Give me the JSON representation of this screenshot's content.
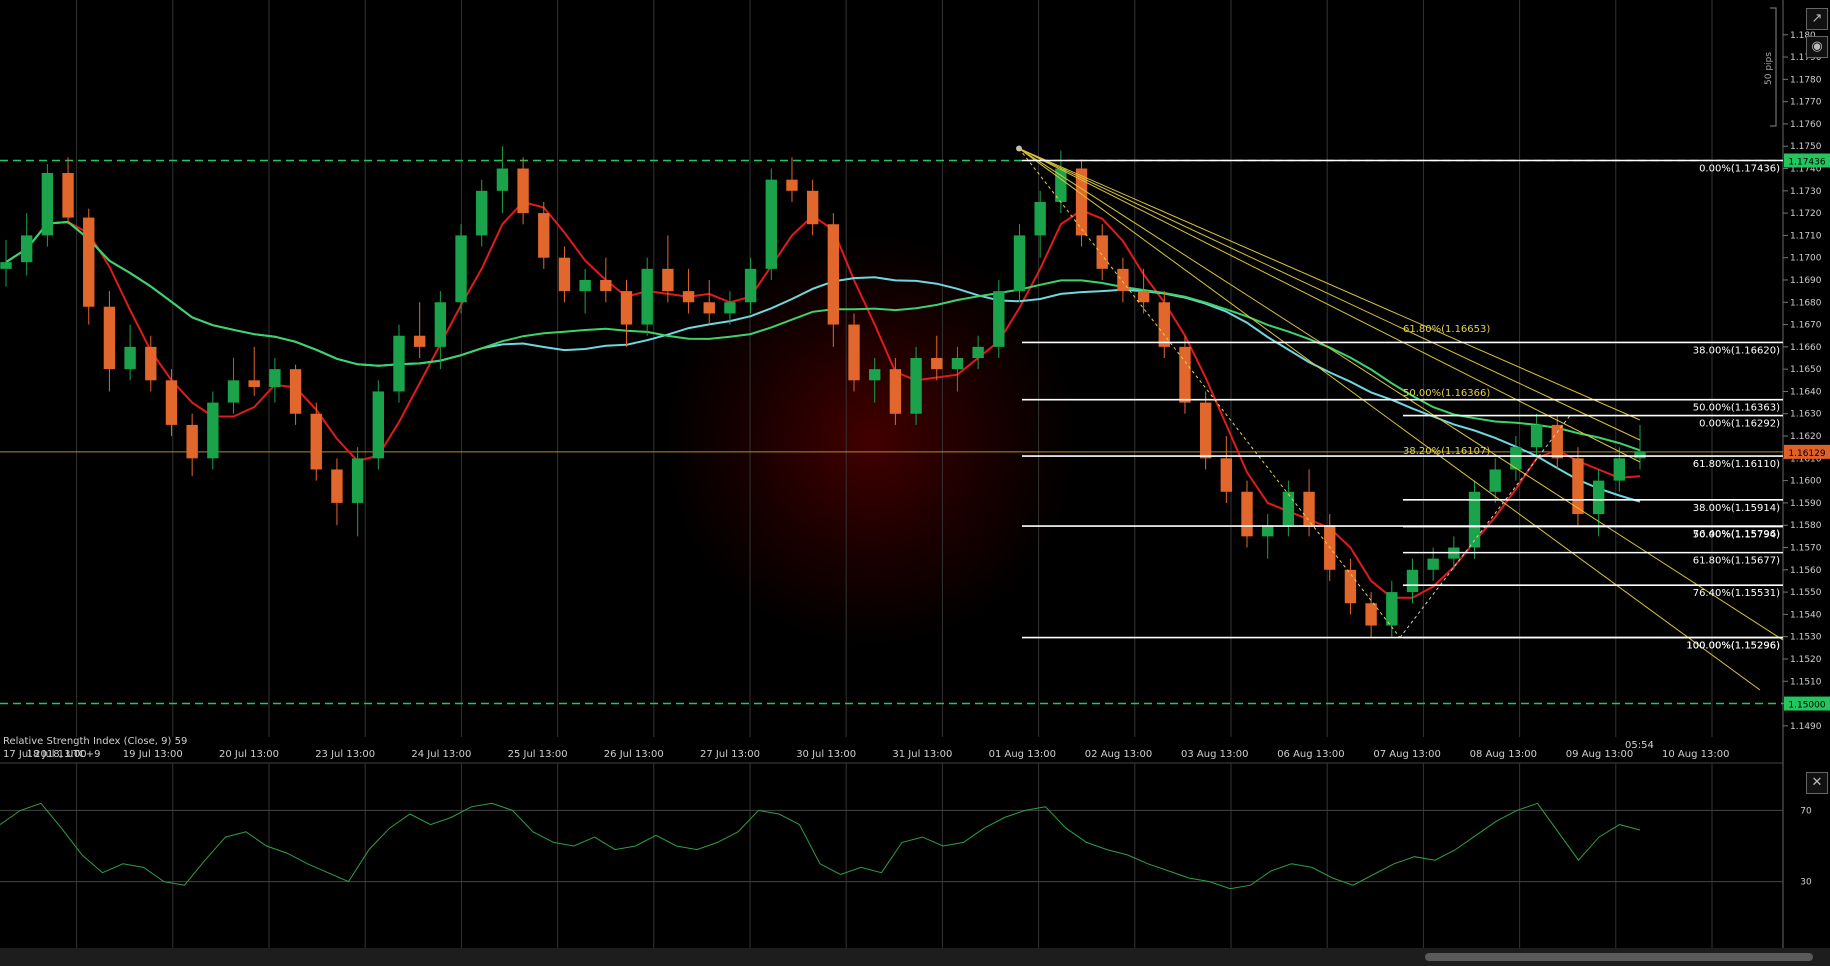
{
  "chart_data": [
    {
      "type": "line",
      "symbol": "",
      "y_range": [
        1.1485,
        1.1812
      ],
      "x_labels": [
        "17 Jul 2018, UTC+9",
        "18 Jul 13:00",
        "19 Jul 13:00",
        "20 Jul 13:00",
        "23 Jul 13:00",
        "24 Jul 13:00",
        "25 Jul 13:00",
        "26 Jul 13:00",
        "27 Jul 13:00",
        "30 Jul 13:00",
        "31 Jul 13:00",
        "01 Aug 13:00",
        "02 Aug 13:00",
        "03 Aug 13:00",
        "06 Aug 13:00",
        "07 Aug 13:00",
        "08 Aug 13:00",
        "09 Aug 13:00",
        "10 Aug 13:00"
      ],
      "y_ticks": [
        "1.1490",
        "1.1500",
        "1.1510",
        "1.1520",
        "1.1530",
        "1.1540",
        "1.1550",
        "1.1560",
        "1.1570",
        "1.1580",
        "1.1590",
        "1.1600",
        "1.1610",
        "1.1620",
        "1.1630",
        "1.1640",
        "1.1650",
        "1.1660",
        "1.1670",
        "1.1680",
        "1.1690",
        "1.1700",
        "1.1710",
        "1.1720",
        "1.1730",
        "1.1740",
        "1.1750",
        "1.1760",
        "1.1770",
        "1.1780",
        "1.1790",
        "1.180"
      ],
      "scale_label": "50 pips",
      "current_price": "1.16129",
      "horizontal_levels": [
        {
          "label": "1.17436",
          "value": 1.17436,
          "color": "#22c55e"
        },
        {
          "label": "1.15000",
          "value": 1.15,
          "color": "#22c55e"
        }
      ],
      "fib_sets": [
        {
          "color": "#ffffff",
          "levels": [
            {
              "label": "0.00%(1.17436)",
              "value": 1.17436
            },
            {
              "label": "38.00%(1.16620)",
              "value": 1.1662
            },
            {
              "label": "50.00%(1.16363)",
              "value": 1.16363
            },
            {
              "label": "61.80%(1.16110)",
              "value": 1.1611
            },
            {
              "label": "76.40%(1.15796)",
              "value": 1.15796
            },
            {
              "label": "100.00%(1.15296)",
              "value": 1.15296
            }
          ]
        },
        {
          "color": "#ffffff",
          "levels": [
            {
              "label": "0.00%(1.16292)",
              "value": 1.16292
            },
            {
              "label": "38.00%(1.15914)",
              "value": 1.15914
            },
            {
              "label": "50.00%(1.15794)",
              "value": 1.15794
            },
            {
              "label": "61.80%(1.15677)",
              "value": 1.15677
            },
            {
              "label": "76.40%(1.15531)",
              "value": 1.15531
            },
            {
              "label": "100.00%(1.15296)",
              "value": 1.15296
            }
          ]
        },
        {
          "color": "#e6d24a",
          "levels": [
            {
              "label": "61.80%(1.16653)",
              "value": 1.16653
            },
            {
              "label": "50.00%(1.16366)",
              "value": 1.16366
            },
            {
              "label": "38.20%(1.16107)",
              "value": 1.16107
            }
          ]
        }
      ],
      "candles": [
        {
          "o": 1.1695,
          "h": 1.1708,
          "l": 1.1687,
          "c": 1.1698
        },
        {
          "o": 1.1698,
          "h": 1.172,
          "l": 1.1692,
          "c": 1.171
        },
        {
          "o": 1.171,
          "h": 1.1742,
          "l": 1.1705,
          "c": 1.1738
        },
        {
          "o": 1.1738,
          "h": 1.1745,
          "l": 1.1715,
          "c": 1.1718
        },
        {
          "o": 1.1718,
          "h": 1.1722,
          "l": 1.167,
          "c": 1.1678
        },
        {
          "o": 1.1678,
          "h": 1.1685,
          "l": 1.164,
          "c": 1.165
        },
        {
          "o": 1.165,
          "h": 1.167,
          "l": 1.1645,
          "c": 1.166
        },
        {
          "o": 1.166,
          "h": 1.1665,
          "l": 1.164,
          "c": 1.1645
        },
        {
          "o": 1.1645,
          "h": 1.165,
          "l": 1.162,
          "c": 1.1625
        },
        {
          "o": 1.1625,
          "h": 1.163,
          "l": 1.1602,
          "c": 1.161
        },
        {
          "o": 1.161,
          "h": 1.164,
          "l": 1.1605,
          "c": 1.1635
        },
        {
          "o": 1.1635,
          "h": 1.1655,
          "l": 1.163,
          "c": 1.1645
        },
        {
          "o": 1.1645,
          "h": 1.166,
          "l": 1.1638,
          "c": 1.1642
        },
        {
          "o": 1.1642,
          "h": 1.1655,
          "l": 1.1635,
          "c": 1.165
        },
        {
          "o": 1.165,
          "h": 1.1652,
          "l": 1.1625,
          "c": 1.163
        },
        {
          "o": 1.163,
          "h": 1.1635,
          "l": 1.16,
          "c": 1.1605
        },
        {
          "o": 1.1605,
          "h": 1.161,
          "l": 1.158,
          "c": 1.159
        },
        {
          "o": 1.159,
          "h": 1.1615,
          "l": 1.1575,
          "c": 1.161
        },
        {
          "o": 1.161,
          "h": 1.1645,
          "l": 1.1605,
          "c": 1.164
        },
        {
          "o": 1.164,
          "h": 1.167,
          "l": 1.1635,
          "c": 1.1665
        },
        {
          "o": 1.1665,
          "h": 1.168,
          "l": 1.1655,
          "c": 1.166
        },
        {
          "o": 1.166,
          "h": 1.1685,
          "l": 1.165,
          "c": 1.168
        },
        {
          "o": 1.168,
          "h": 1.1715,
          "l": 1.1675,
          "c": 1.171
        },
        {
          "o": 1.171,
          "h": 1.1735,
          "l": 1.1705,
          "c": 1.173
        },
        {
          "o": 1.173,
          "h": 1.175,
          "l": 1.172,
          "c": 1.174
        },
        {
          "o": 1.174,
          "h": 1.1745,
          "l": 1.1715,
          "c": 1.172
        },
        {
          "o": 1.172,
          "h": 1.1725,
          "l": 1.1695,
          "c": 1.17
        },
        {
          "o": 1.17,
          "h": 1.1705,
          "l": 1.168,
          "c": 1.1685
        },
        {
          "o": 1.1685,
          "h": 1.1695,
          "l": 1.1675,
          "c": 1.169
        },
        {
          "o": 1.169,
          "h": 1.17,
          "l": 1.168,
          "c": 1.1685
        },
        {
          "o": 1.1685,
          "h": 1.169,
          "l": 1.166,
          "c": 1.167
        },
        {
          "o": 1.167,
          "h": 1.17,
          "l": 1.1665,
          "c": 1.1695
        },
        {
          "o": 1.1695,
          "h": 1.171,
          "l": 1.168,
          "c": 1.1685
        },
        {
          "o": 1.1685,
          "h": 1.1695,
          "l": 1.1675,
          "c": 1.168
        },
        {
          "o": 1.168,
          "h": 1.169,
          "l": 1.167,
          "c": 1.1675
        },
        {
          "o": 1.1675,
          "h": 1.1685,
          "l": 1.167,
          "c": 1.168
        },
        {
          "o": 1.168,
          "h": 1.17,
          "l": 1.1675,
          "c": 1.1695
        },
        {
          "o": 1.1695,
          "h": 1.174,
          "l": 1.169,
          "c": 1.1735
        },
        {
          "o": 1.1735,
          "h": 1.1745,
          "l": 1.1725,
          "c": 1.173
        },
        {
          "o": 1.173,
          "h": 1.1735,
          "l": 1.171,
          "c": 1.1715
        },
        {
          "o": 1.1715,
          "h": 1.172,
          "l": 1.166,
          "c": 1.167
        },
        {
          "o": 1.167,
          "h": 1.1675,
          "l": 1.164,
          "c": 1.1645
        },
        {
          "o": 1.1645,
          "h": 1.1655,
          "l": 1.1635,
          "c": 1.165
        },
        {
          "o": 1.165,
          "h": 1.1655,
          "l": 1.1625,
          "c": 1.163
        },
        {
          "o": 1.163,
          "h": 1.166,
          "l": 1.1625,
          "c": 1.1655
        },
        {
          "o": 1.1655,
          "h": 1.1665,
          "l": 1.1645,
          "c": 1.165
        },
        {
          "o": 1.165,
          "h": 1.166,
          "l": 1.164,
          "c": 1.1655
        },
        {
          "o": 1.1655,
          "h": 1.1665,
          "l": 1.165,
          "c": 1.166
        },
        {
          "o": 1.166,
          "h": 1.169,
          "l": 1.1655,
          "c": 1.1685
        },
        {
          "o": 1.1685,
          "h": 1.1715,
          "l": 1.168,
          "c": 1.171
        },
        {
          "o": 1.171,
          "h": 1.173,
          "l": 1.17,
          "c": 1.1725
        },
        {
          "o": 1.1725,
          "h": 1.1748,
          "l": 1.172,
          "c": 1.174
        },
        {
          "o": 1.174,
          "h": 1.1744,
          "l": 1.1705,
          "c": 1.171
        },
        {
          "o": 1.171,
          "h": 1.1715,
          "l": 1.169,
          "c": 1.1695
        },
        {
          "o": 1.1695,
          "h": 1.17,
          "l": 1.168,
          "c": 1.1685
        },
        {
          "o": 1.1685,
          "h": 1.1695,
          "l": 1.1675,
          "c": 1.168
        },
        {
          "o": 1.168,
          "h": 1.1685,
          "l": 1.1655,
          "c": 1.166
        },
        {
          "o": 1.166,
          "h": 1.1665,
          "l": 1.163,
          "c": 1.1635
        },
        {
          "o": 1.1635,
          "h": 1.164,
          "l": 1.1605,
          "c": 1.161
        },
        {
          "o": 1.161,
          "h": 1.162,
          "l": 1.159,
          "c": 1.1595
        },
        {
          "o": 1.1595,
          "h": 1.16,
          "l": 1.157,
          "c": 1.1575
        },
        {
          "o": 1.1575,
          "h": 1.1585,
          "l": 1.1565,
          "c": 1.158
        },
        {
          "o": 1.158,
          "h": 1.16,
          "l": 1.1575,
          "c": 1.1595
        },
        {
          "o": 1.1595,
          "h": 1.1605,
          "l": 1.1575,
          "c": 1.158
        },
        {
          "o": 1.158,
          "h": 1.1585,
          "l": 1.1555,
          "c": 1.156
        },
        {
          "o": 1.156,
          "h": 1.1565,
          "l": 1.154,
          "c": 1.1545
        },
        {
          "o": 1.1545,
          "h": 1.155,
          "l": 1.15296,
          "c": 1.1535
        },
        {
          "o": 1.1535,
          "h": 1.1555,
          "l": 1.153,
          "c": 1.155
        },
        {
          "o": 1.155,
          "h": 1.1565,
          "l": 1.1545,
          "c": 1.156
        },
        {
          "o": 1.156,
          "h": 1.157,
          "l": 1.1555,
          "c": 1.1565
        },
        {
          "o": 1.1565,
          "h": 1.1575,
          "l": 1.156,
          "c": 1.157
        },
        {
          "o": 1.157,
          "h": 1.16,
          "l": 1.1565,
          "c": 1.1595
        },
        {
          "o": 1.1595,
          "h": 1.161,
          "l": 1.159,
          "c": 1.1605
        },
        {
          "o": 1.1605,
          "h": 1.162,
          "l": 1.16,
          "c": 1.1615
        },
        {
          "o": 1.1615,
          "h": 1.163,
          "l": 1.161,
          "c": 1.1625
        },
        {
          "o": 1.1625,
          "h": 1.16292,
          "l": 1.1605,
          "c": 1.161
        },
        {
          "o": 1.161,
          "h": 1.1615,
          "l": 1.158,
          "c": 1.1585
        },
        {
          "o": 1.1585,
          "h": 1.1605,
          "l": 1.1575,
          "c": 1.16
        },
        {
          "o": 1.16,
          "h": 1.1615,
          "l": 1.1595,
          "c": 1.161
        },
        {
          "o": 1.161,
          "h": 1.1625,
          "l": 1.1605,
          "c": 1.16129
        }
      ]
    },
    {
      "type": "line",
      "title": "Relative Strength Index (Close, 9) 59",
      "y_range": [
        0,
        100
      ],
      "levels": [
        30,
        70
      ],
      "y_ticks": [
        "70",
        "30"
      ],
      "values": [
        62,
        70,
        74,
        60,
        45,
        35,
        40,
        38,
        30,
        28,
        42,
        55,
        58,
        50,
        46,
        40,
        35,
        30,
        48,
        60,
        68,
        62,
        66,
        72,
        74,
        70,
        58,
        52,
        50,
        55,
        48,
        50,
        56,
        50,
        48,
        52,
        58,
        70,
        68,
        62,
        40,
        34,
        38,
        35,
        52,
        55,
        50,
        52,
        60,
        66,
        70,
        72,
        60,
        52,
        48,
        45,
        40,
        36,
        32,
        30,
        26,
        28,
        36,
        40,
        38,
        32,
        28,
        34,
        40,
        44,
        42,
        48,
        56,
        64,
        70,
        74,
        58,
        42,
        55,
        62,
        59
      ]
    }
  ],
  "overlay": {
    "time_label": "05:54"
  },
  "icons": {
    "pop_out": "pop-out-icon",
    "camera": "camera-icon",
    "close": "close-icon"
  }
}
